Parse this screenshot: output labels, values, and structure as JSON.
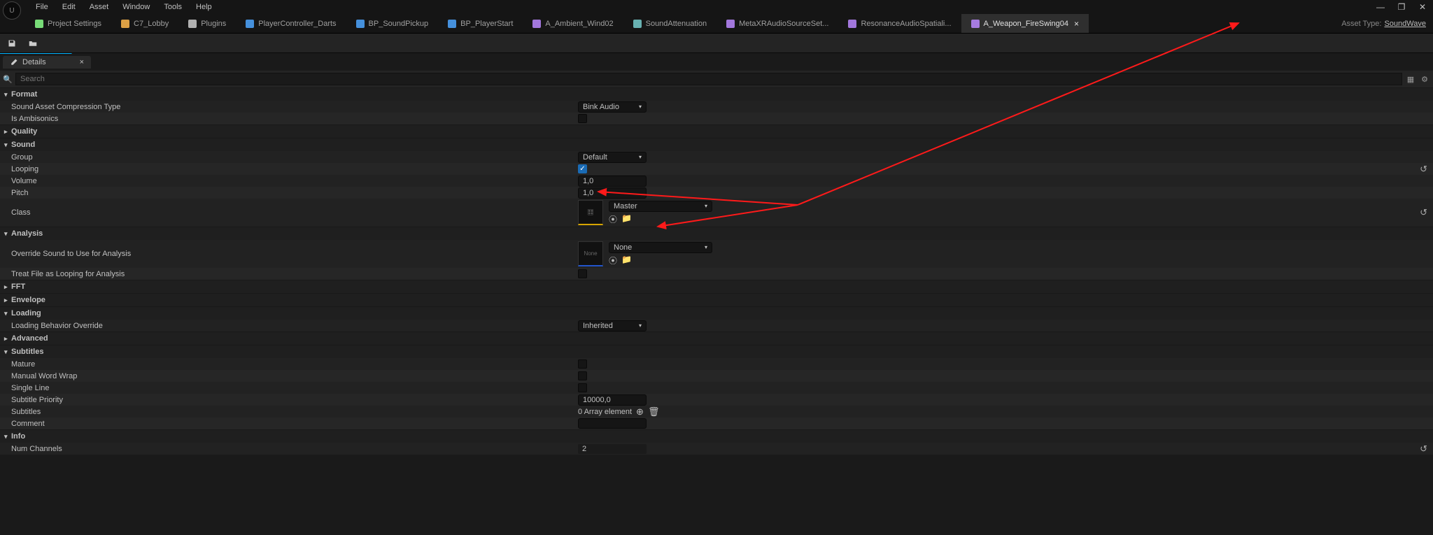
{
  "menu": {
    "items": [
      "File",
      "Edit",
      "Asset",
      "Window",
      "Tools",
      "Help"
    ]
  },
  "window_controls": {
    "min": "—",
    "max": "❐",
    "close": "✕"
  },
  "tabs": [
    {
      "label": "Project Settings",
      "icon": "gear",
      "color": "#8aff8a"
    },
    {
      "label": "C7_Lobby",
      "icon": "level",
      "color": "#ffb84d"
    },
    {
      "label": "Plugins",
      "icon": "plugin",
      "color": "#cccccc"
    },
    {
      "label": "PlayerController_Darts",
      "icon": "bp",
      "color": "#4da6ff"
    },
    {
      "label": "BP_SoundPickup",
      "icon": "bp",
      "color": "#4da6ff"
    },
    {
      "label": "BP_PlayerStart",
      "icon": "bp",
      "color": "#4da6ff"
    },
    {
      "label": "A_Ambient_Wind02",
      "icon": "sound",
      "color": "#bb88ff"
    },
    {
      "label": "SoundAttenuation",
      "icon": "sound",
      "color": "#77cccc"
    },
    {
      "label": "MetaXRAudioSourceSet...",
      "icon": "sound",
      "color": "#bb88ff"
    },
    {
      "label": "ResonanceAudioSpatiali...",
      "icon": "sound",
      "color": "#bb88ff"
    },
    {
      "label": "A_Weapon_FireSwing04",
      "icon": "sound",
      "color": "#bb88ff",
      "active": true
    }
  ],
  "asset_type": {
    "label": "Asset Type:",
    "value": "SoundWave"
  },
  "panel": {
    "title": "Details",
    "search_placeholder": "Search"
  },
  "sections": {
    "format": {
      "title": "Format",
      "compression_label": "Sound Asset Compression Type",
      "compression_value": "Bink Audio",
      "ambisonics_label": "Is Ambisonics"
    },
    "quality": {
      "title": "Quality"
    },
    "sound": {
      "title": "Sound",
      "group_label": "Group",
      "group_value": "Default",
      "looping_label": "Looping",
      "looping_checked": true,
      "volume_label": "Volume",
      "volume_value": "1,0",
      "pitch_label": "Pitch",
      "pitch_value": "1,0",
      "class_label": "Class",
      "class_value": "Master"
    },
    "analysis": {
      "title": "Analysis",
      "override_label": "Override Sound to Use for Analysis",
      "override_value": "None",
      "treat_loop_label": "Treat File as Looping for Analysis"
    },
    "fft": {
      "title": "FFT"
    },
    "envelope": {
      "title": "Envelope"
    },
    "loading": {
      "title": "Loading",
      "behavior_label": "Loading Behavior Override",
      "behavior_value": "Inherited"
    },
    "advanced": {
      "title": "Advanced"
    },
    "subtitles": {
      "title": "Subtitles",
      "mature_label": "Mature",
      "wrap_label": "Manual Word Wrap",
      "single_label": "Single Line",
      "priority_label": "Subtitle Priority",
      "priority_value": "10000,0",
      "subs_label": "Subtitles",
      "subs_count": "0 Array element",
      "comment_label": "Comment"
    },
    "info": {
      "title": "Info",
      "channels_label": "Num Channels",
      "channels_value": "2"
    }
  },
  "icons": {
    "reset": "↺",
    "add": "⊕",
    "trash": "🗑",
    "folder": "📁",
    "use": "⦿"
  }
}
